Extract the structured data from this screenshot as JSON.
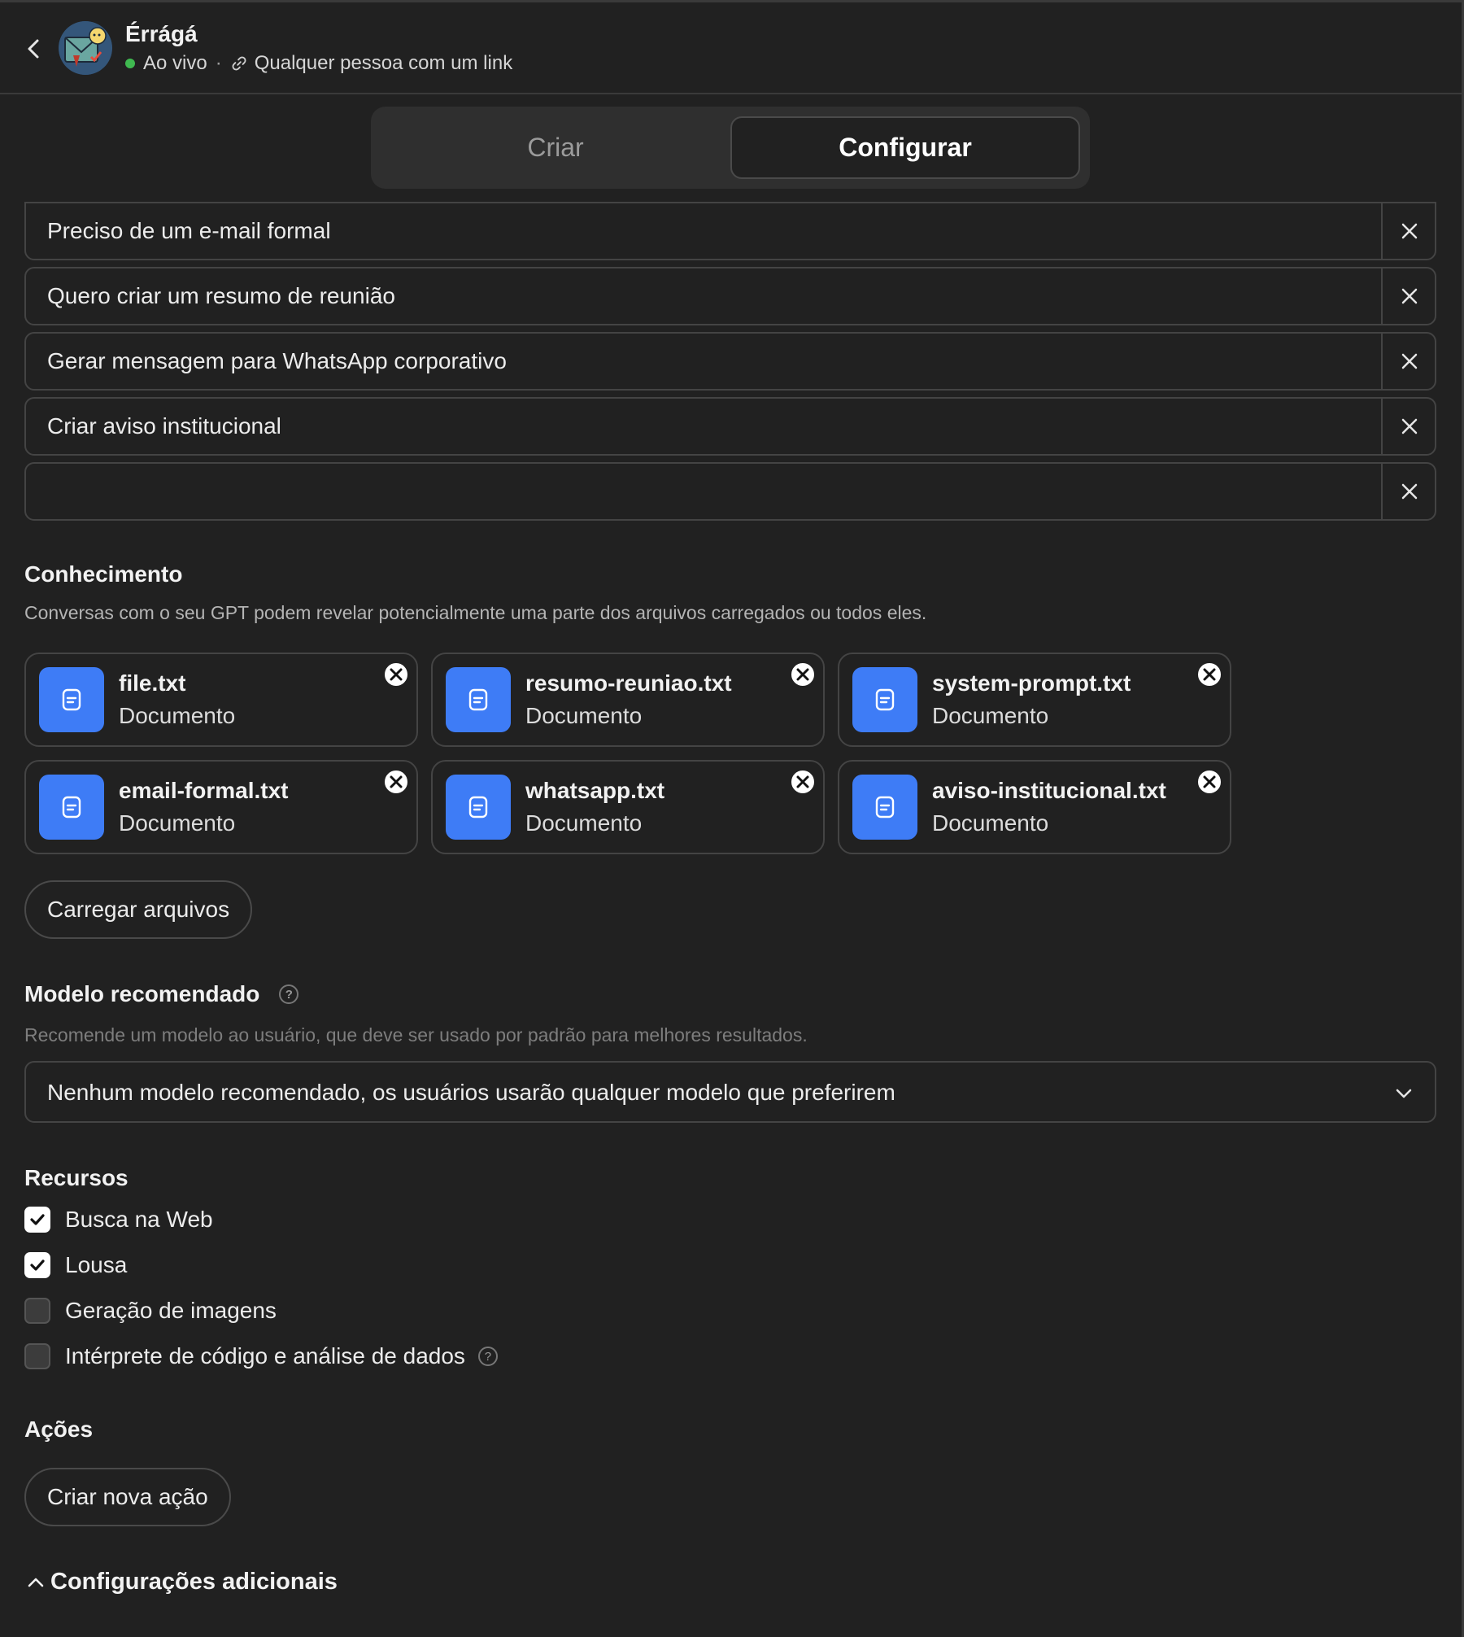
{
  "header": {
    "gpt_name": "Érrágá",
    "status": "Ao vivo",
    "separator": "·",
    "visibility": "Qualquer pessoa com um link",
    "status_color": "#3fb950"
  },
  "tabs": [
    {
      "label": "Criar",
      "active": false
    },
    {
      "label": "Configurar",
      "active": true
    }
  ],
  "conversation_starters": [
    {
      "value": "Preciso de um e-mail formal"
    },
    {
      "value": "Quero criar um resumo de reunião"
    },
    {
      "value": "Gerar mensagem para WhatsApp corporativo"
    },
    {
      "value": "Criar aviso institucional"
    },
    {
      "value": ""
    }
  ],
  "knowledge": {
    "title": "Conhecimento",
    "description": "Conversas com o seu GPT podem revelar potencialmente uma parte dos arquivos carregados ou todos eles.",
    "files": [
      {
        "name": "file.txt",
        "type": "Documento"
      },
      {
        "name": "resumo-reuniao.txt",
        "type": "Documento"
      },
      {
        "name": "system-prompt.txt",
        "type": "Documento"
      },
      {
        "name": "email-formal.txt",
        "type": "Documento"
      },
      {
        "name": "whatsapp.txt",
        "type": "Documento"
      },
      {
        "name": "aviso-institucional.txt",
        "type": "Documento"
      }
    ],
    "upload_label": "Carregar arquivos",
    "file_icon_color": "#3e7cf6"
  },
  "recommended_model": {
    "title": "Modelo recomendado",
    "help": "?",
    "description": "Recomende um modelo ao usuário, que deve ser usado por padrão para melhores resultados.",
    "selected": "Nenhum modelo recomendado, os usuários usarão qualquer modelo que preferirem"
  },
  "capabilities": {
    "title": "Recursos",
    "items": [
      {
        "label": "Busca na Web",
        "checked": true
      },
      {
        "label": "Lousa",
        "checked": true
      },
      {
        "label": "Geração de imagens",
        "checked": false
      },
      {
        "label": "Intérprete de código e análise de dados",
        "checked": false,
        "help": "?"
      }
    ]
  },
  "actions": {
    "title": "Ações",
    "button_label": "Criar nova ação"
  },
  "additional_settings": {
    "label": "Configurações adicionais"
  }
}
